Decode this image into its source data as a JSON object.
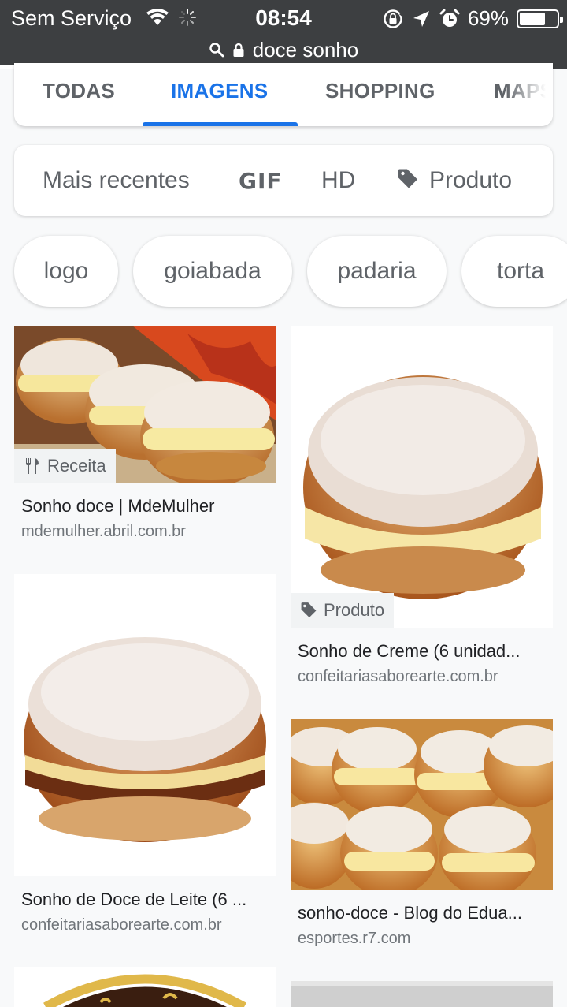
{
  "status_bar": {
    "carrier": "Sem Serviço",
    "time": "08:54",
    "battery_percent": "69%",
    "battery_level": 0.69,
    "url": "doce sonho"
  },
  "tabs": [
    {
      "label": "TODAS",
      "active": false
    },
    {
      "label": "IMAGENS",
      "active": true
    },
    {
      "label": "SHOPPING",
      "active": false
    },
    {
      "label": "MAPS",
      "active": false
    }
  ],
  "filters": {
    "recent": "Mais recentes",
    "gif": "GIF",
    "hd": "HD",
    "product": "Produto"
  },
  "chips": [
    "logo",
    "goiabada",
    "padaria",
    "torta"
  ],
  "results": [
    {
      "title": "Sonho doce | MdeMulher",
      "domain": "mdemulher.abril.com.br",
      "badge": "Receita",
      "badge_icon": "utensils-icon"
    },
    {
      "title": "Sonho de Creme (6 unidad...",
      "domain": "confeitariasaborearte.com.br",
      "badge": "Produto",
      "badge_icon": "tag-icon"
    },
    {
      "title": "Sonho de Doce de Leite (6 ...",
      "domain": "confeitariasaborearte.com.br"
    },
    {
      "title": "sonho-doce - Blog do Edua...",
      "domain": "esportes.r7.com"
    }
  ],
  "colors": {
    "accent": "#1a73e8",
    "status_bar_bg": "#3d3f41",
    "page_bg": "#f8f9fa",
    "text_secondary": "#5f6368"
  }
}
